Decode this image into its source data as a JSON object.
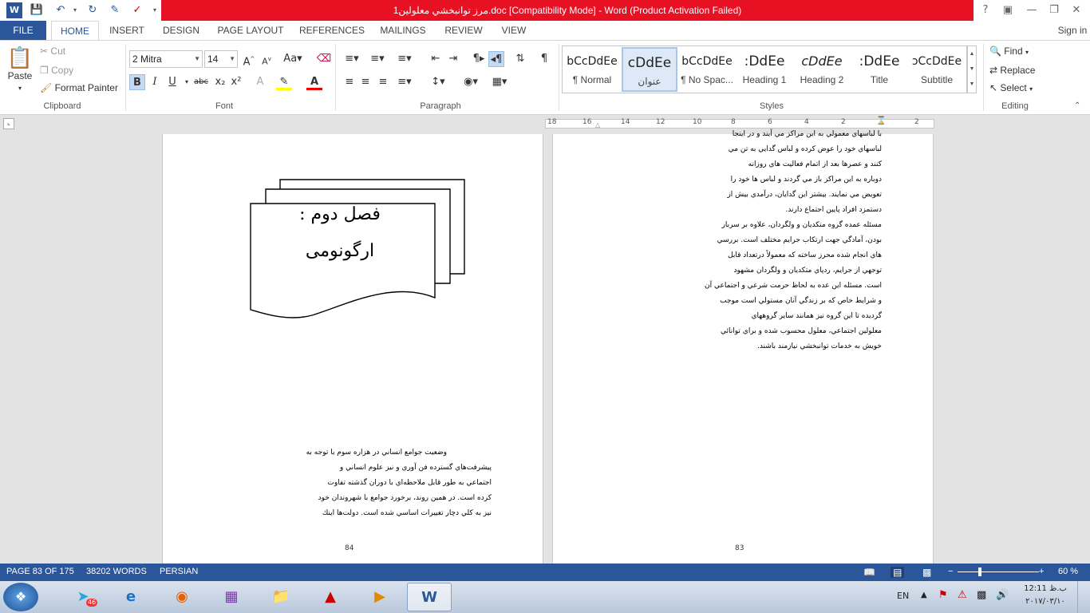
{
  "window": {
    "title": "مرز توانبخشي معلولين1.doc [Compatibility Mode] -  Word (Product Activation Failed)",
    "help": "?",
    "minimize": "—",
    "restore": "❐",
    "close": "✕"
  },
  "tabs": [
    "FILE",
    "HOME",
    "INSERT",
    "DESIGN",
    "PAGE LAYOUT",
    "REFERENCES",
    "MAILINGS",
    "REVIEW",
    "VIEW"
  ],
  "sign_in": "Sign in",
  "clipboard": {
    "paste": "Paste",
    "cut": "Cut",
    "copy": "Copy",
    "format_painter": "Format Painter",
    "label": "Clipboard"
  },
  "font": {
    "name": "2  Mitra",
    "size": "14",
    "bold": "B",
    "italic": "I",
    "underline": "U",
    "strike": "abc",
    "sub": "x₂",
    "sup": "x²",
    "label": "Font"
  },
  "paragraph": {
    "label": "Paragraph",
    "pilcrow": "¶"
  },
  "styles": {
    "label": "Styles",
    "items": [
      {
        "preview": "bCcDdEe",
        "name": "¶ Normal"
      },
      {
        "preview": "cDdEe",
        "name": "عنوان"
      },
      {
        "preview": "bCcDdEe",
        "name": "¶ No Spac..."
      },
      {
        "preview": ":DdEe",
        "name": "Heading 1"
      },
      {
        "preview": "cDdEe",
        "name": "Heading 2"
      },
      {
        "preview": ":DdEe",
        "name": "Title"
      },
      {
        "preview": "ɔCcDdEe",
        "name": "Subtitle"
      }
    ]
  },
  "editing": {
    "find": "Find",
    "replace": "Replace",
    "select": "Select",
    "label": "Editing"
  },
  "ruler": [
    "18",
    "16",
    "14",
    "12",
    "10",
    "8",
    "6",
    "4",
    "2",
    "2"
  ],
  "left_page": {
    "heading_line1": "فصل دوم  :",
    "heading_line2": "ارگونومی",
    "lines": [
      "وضعيت جوامع انساني در هزاره سوم با توجه به",
      "پيشرفت‌هاي گسترده فن آوري و نيز علوم انساني و",
      "اجتماعي به طور قابل ملاحظه‌اي با دوران گذشته تفاوت",
      "كرده است. در همين روند، برخورد جوامع با شهروندان خود",
      "نيز به كلي دچار تغييرات اساسي شده است. دولت‌ها اينك"
    ],
    "page_number": "84"
  },
  "right_page": {
    "lines": [
      "با لباسهاي معمولي به اين مراكز مي آيند و در اينجا",
      "لباسهاي خود را عوض كرده و لباس گدايي به تن مي",
      "كنند و عصرها بعد از اتمام فعاليت هاي روزانه",
      "دوباره به اين مراكز باز مي گردند و لباس ها خود را",
      "تعويض مي نمايند. بيشتر اين گدايان، درآمدي بيش از",
      "دستمزد افراد پايين اجتماع دارند.",
      "مسئله عمده گروه متكديان و ولگردان، علاوه بر سربار",
      "بودن، آمادگي جهت ارتكاب جرايم مختلف است. بررسي",
      "هاي انجام شده محرز ساخته كه معمولاً درتعداد قابل",
      "توجهي از جرايم، ردپاي متكديان و ولگردان مشهود",
      "است. مسئله اين عده به لحاظ حرمت شرعي و اجتماعي آن",
      "و شرايط خاص كه بر زندگي آنان مستولي است موجب",
      "گرديده تا اين گروه نيز همانند ساير گروههاي",
      "معلولين اجتماعي، معلول محسوب شده و براي توانائي",
      "خويش به خدمات توانبخشي نيازمند باشند."
    ],
    "page_number": "83"
  },
  "status": {
    "page": "PAGE 83 OF 175",
    "words": "38202 WORDS",
    "language": "PERSIAN",
    "zoom": "60 %"
  },
  "taskbar": {
    "lang": "EN",
    "time": "12:11 ب.ظ",
    "date": "۲۰۱۷/۰۳/۱۰",
    "telegram_badge": "46"
  }
}
